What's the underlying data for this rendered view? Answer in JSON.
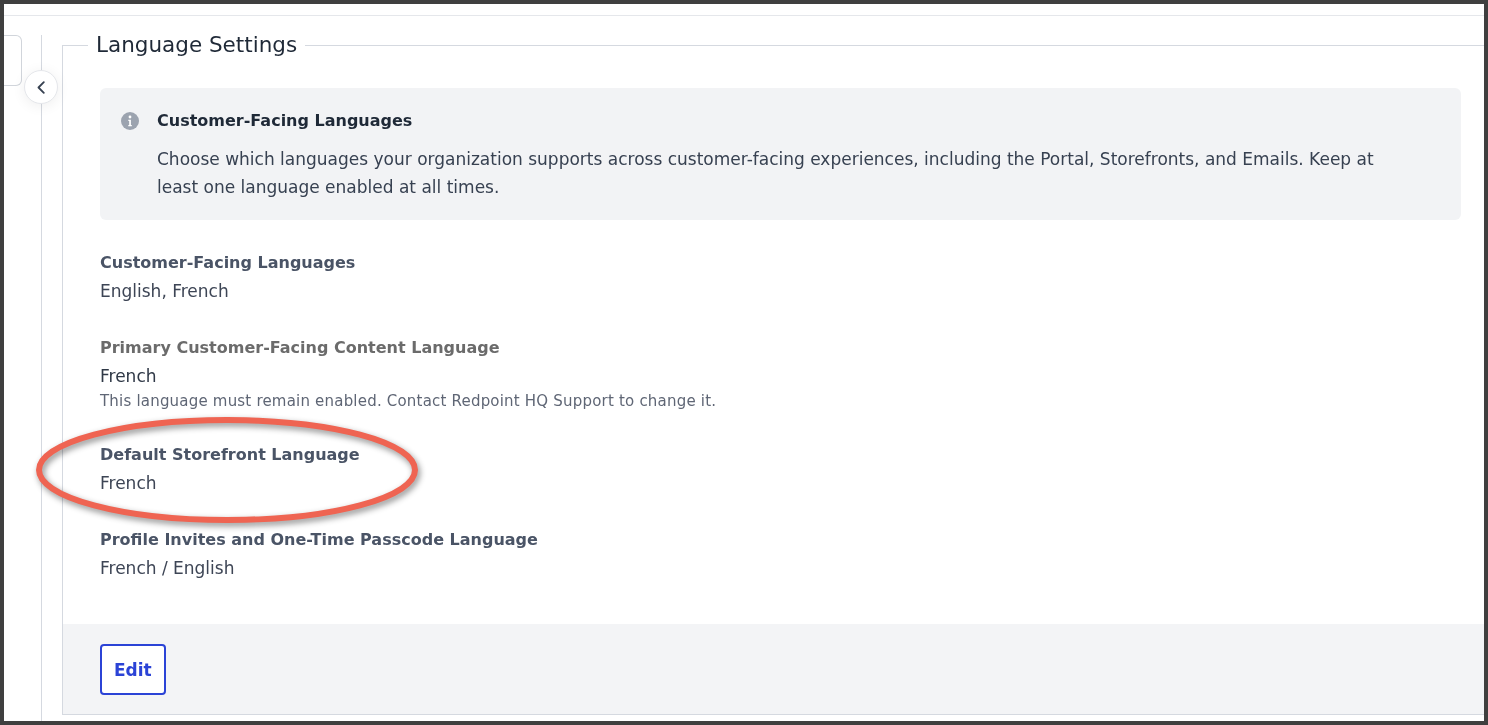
{
  "section": {
    "title": "Language Settings"
  },
  "info_box": {
    "title": "Customer-Facing Languages",
    "text": "Choose which languages your organization supports across customer-facing experiences, including the Portal, Storefronts, and Emails. Keep at least one language enabled at all times."
  },
  "fields": [
    {
      "label": "Customer-Facing Languages",
      "value": "English, French",
      "locked": false,
      "highlighted": false
    },
    {
      "label": "Primary Customer-Facing Content Language",
      "value": "French",
      "note": "This language must remain enabled. Contact Redpoint HQ Support to change it.",
      "locked": true,
      "highlighted": false
    },
    {
      "label": "Default Storefront Language",
      "value": "French",
      "locked": false,
      "highlighted": true
    },
    {
      "label": "Profile Invites and One-Time Passcode Language",
      "value": "French / English",
      "locked": false,
      "highlighted": false
    }
  ],
  "footer": {
    "buttons": [
      "Edit"
    ]
  }
}
